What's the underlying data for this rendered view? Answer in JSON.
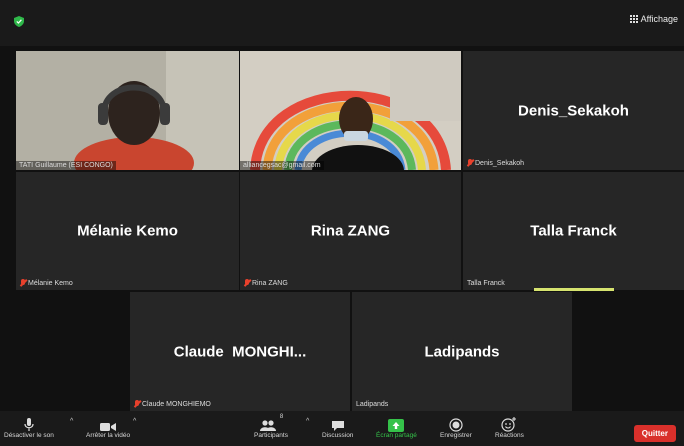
{
  "topbar": {
    "view_label": "Affichage"
  },
  "participants": [
    {
      "name": "TATI Guillaume (ESI CONGO)",
      "display": "",
      "muted": false,
      "video": true
    },
    {
      "name": "alliancegsac@gmail.com",
      "display": "",
      "muted": false,
      "video": true
    },
    {
      "name": "Denis_Sekakoh",
      "display": "Denis_Sekakoh",
      "muted": true,
      "video": false
    },
    {
      "name": "Mélanie Kemo",
      "display": "Mélanie Kemo",
      "muted": true,
      "video": false
    },
    {
      "name": "Rina ZANG",
      "display": "Rina ZANG",
      "muted": true,
      "video": false
    },
    {
      "name": "Talla Franck",
      "display": "Talla Franck",
      "muted": false,
      "video": false
    },
    {
      "name": "Claude MONGHIEMO",
      "display": "Claude  MONGHI...",
      "muted": true,
      "video": false
    },
    {
      "name": "Ladipands",
      "display": "Ladipands",
      "muted": false,
      "video": false
    }
  ],
  "toolbar": {
    "audio": "Désactiver le son",
    "video": "Arrêter la vidéo",
    "participants": "Participants",
    "participants_count": "8",
    "chat": "Discussion",
    "share": "Écran partagé",
    "record": "Enregistrer",
    "reactions": "Réactions",
    "quit": "Quitter"
  },
  "colors": {
    "accent_green": "#35c24a",
    "speaker_highlight": "#d6e36f",
    "quit_red": "#d9302b",
    "mute_red": "#e8412c"
  }
}
